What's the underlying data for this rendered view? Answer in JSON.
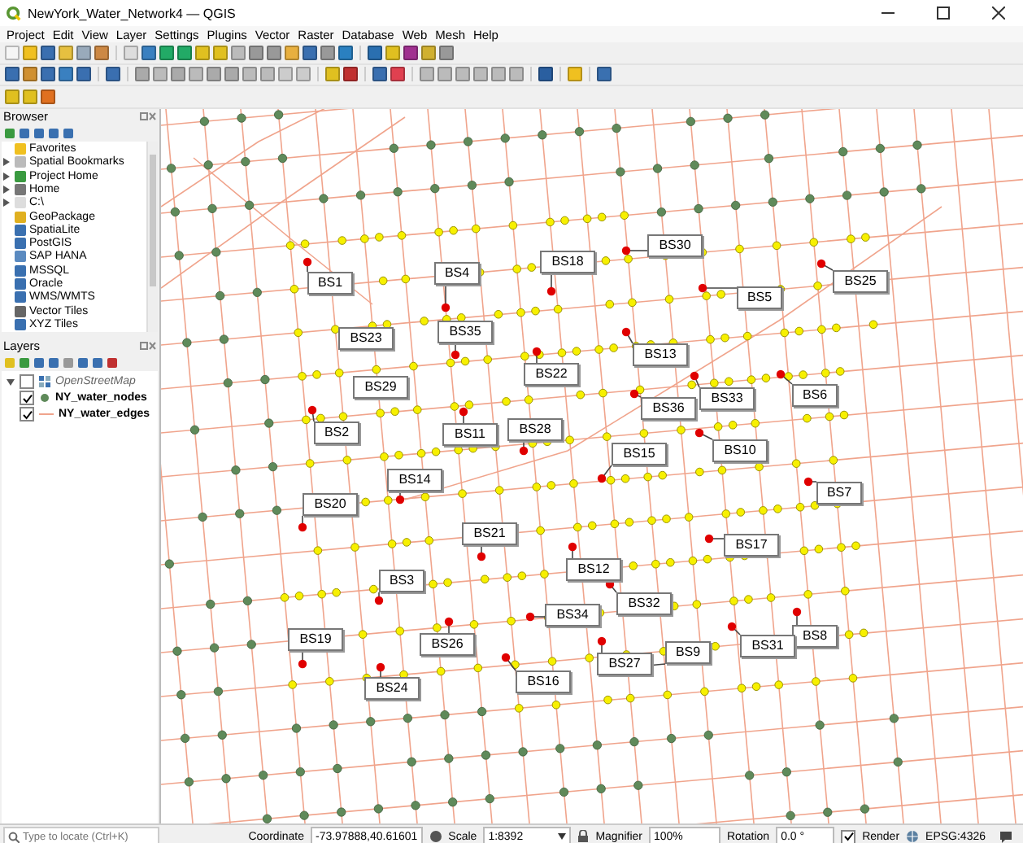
{
  "window": {
    "title": "NewYork_Water_Network4 — QGIS"
  },
  "menu": [
    "Project",
    "Edit",
    "View",
    "Layer",
    "Settings",
    "Plugins",
    "Vector",
    "Raster",
    "Database",
    "Web",
    "Mesh",
    "Help"
  ],
  "browser": {
    "title": "Browser",
    "items": [
      {
        "label": "Favorites",
        "expander": false
      },
      {
        "label": "Spatial Bookmarks",
        "expander": true
      },
      {
        "label": "Project Home",
        "expander": true
      },
      {
        "label": "Home",
        "expander": true
      },
      {
        "label": "C:\\",
        "expander": true
      },
      {
        "label": "GeoPackage",
        "expander": false
      },
      {
        "label": "SpatiaLite",
        "expander": false
      },
      {
        "label": "PostGIS",
        "expander": false
      },
      {
        "label": "SAP HANA",
        "expander": false
      },
      {
        "label": "MSSQL",
        "expander": false
      },
      {
        "label": "Oracle",
        "expander": false
      },
      {
        "label": "WMS/WMTS",
        "expander": false
      },
      {
        "label": "Vector Tiles",
        "expander": false
      },
      {
        "label": "XYZ Tiles",
        "expander": false
      }
    ]
  },
  "layers": {
    "title": "Layers",
    "items": [
      {
        "label": "OpenStreetMap",
        "checked": false,
        "kind": "basemap"
      },
      {
        "label": "NY_water_nodes",
        "checked": true,
        "kind": "point"
      },
      {
        "label": "NY_water_edges",
        "checked": true,
        "kind": "line"
      }
    ]
  },
  "map": {
    "labels": [
      "BS1",
      "BS4",
      "BS18",
      "BS30",
      "BS5",
      "BS25",
      "BS23",
      "BS35",
      "BS13",
      "BS22",
      "BS33",
      "BS6",
      "BS29",
      "BS36",
      "BS2",
      "BS11",
      "BS28",
      "BS15",
      "BS10",
      "BS14",
      "BS7",
      "BS20",
      "BS21",
      "BS17",
      "BS12",
      "BS3",
      "BS32",
      "BS34",
      "BS19",
      "BS26",
      "BS8",
      "BS31",
      "BS27",
      "BS9",
      "BS24",
      "BS16"
    ]
  },
  "status_bar": {
    "locator_placeholder": "Type to locate (Ctrl+K)",
    "coordinate_label": "Coordinate",
    "coordinate": "-73.97888,40.61601",
    "scale_label": "Scale",
    "scale": "1:8392",
    "magnifier_label": "Magnifier",
    "magnifier": "100%",
    "rotation_label": "Rotation",
    "rotation": "0.0 °",
    "render_checked": true,
    "render_label": "Render",
    "crs": "EPSG:4326"
  }
}
